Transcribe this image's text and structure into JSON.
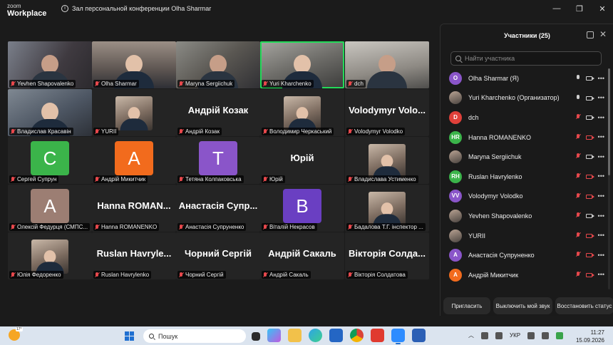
{
  "titlebar": {
    "logo_top": "zoom",
    "logo_bottom": "Workplace",
    "meeting_title": "Зал персональной конференции Olha Sharmar"
  },
  "gallery": {
    "tiles": [
      {
        "name": "Yevhen Shapovalenko",
        "kind": "video"
      },
      {
        "name": "Olha Sharmar",
        "kind": "video"
      },
      {
        "name": "Maryna Sergiichuk",
        "kind": "video"
      },
      {
        "name": "Yuri Kharchenko",
        "kind": "video",
        "active": true
      },
      {
        "name": "dch",
        "kind": "video"
      },
      {
        "name": "Владислав Красавін",
        "kind": "video"
      },
      {
        "name": "YURII",
        "kind": "photo"
      },
      {
        "name": "Андрій Козак",
        "big": "Андрій Козак",
        "kind": "text"
      },
      {
        "name": "Володимир Черкаський",
        "kind": "photo"
      },
      {
        "name": "Volodymyr Volodko",
        "big": "Volodymyr Volo...",
        "kind": "text"
      },
      {
        "name": "Сергей Супрун",
        "letter": "С",
        "kind": "avatar",
        "color": "#3bb44a"
      },
      {
        "name": "Андрій Микитчик",
        "letter": "А",
        "kind": "avatar",
        "color": "#f26b1d"
      },
      {
        "name": "Тетяна Колпаковська",
        "letter": "Т",
        "kind": "avatar",
        "color": "#8a55c9"
      },
      {
        "name": "Юрій",
        "big": "Юрій",
        "kind": "text"
      },
      {
        "name": "Владислава Устименко",
        "kind": "photo"
      },
      {
        "name": "Олексій Федурця (СМПС...",
        "letter": "А",
        "kind": "avatar",
        "color": "#9c7e73"
      },
      {
        "name": "Hanna ROMANENKO",
        "big": "Hanna ROMAN...",
        "kind": "text"
      },
      {
        "name": "Анастасія Супруненко",
        "big": "Анастасія Супр...",
        "kind": "text"
      },
      {
        "name": "Віталій Некрасов",
        "letter": "В",
        "kind": "avatar",
        "color": "#6a3fc2"
      },
      {
        "name": "Бадалова Т.Г. інспектор ...",
        "kind": "photo"
      },
      {
        "name": "Юлія Федоренко",
        "kind": "photo"
      },
      {
        "name": "Ruslan Havrylenko",
        "big": "Ruslan Havryle...",
        "kind": "text"
      },
      {
        "name": "Чорний Сергій",
        "big": "Чорний Сергій",
        "kind": "text"
      },
      {
        "name": "Андрій Сакаль",
        "big": "Андрій Сакаль",
        "kind": "text"
      },
      {
        "name": "Вікторія Солдатова",
        "big": "Вікторія Солда...",
        "kind": "text"
      }
    ]
  },
  "participants_panel": {
    "title": "Участники (25)",
    "search_placeholder": "Найти участника",
    "items": [
      {
        "name": "Olha Sharmar (Я)",
        "avatar": "O",
        "color": "#8a55c9",
        "mic_on": true,
        "cam_on": true
      },
      {
        "name": "Yuri Kharchenko (Организатор)",
        "avatar": "",
        "photo": true,
        "mic_on": true,
        "cam_on": true
      },
      {
        "name": "dch",
        "avatar": "D",
        "color": "#e0403a",
        "mic_on": false,
        "cam_on": true
      },
      {
        "name": "Hanna ROMANENKO",
        "avatar": "HR",
        "color": "#3bb44a",
        "mic_on": false,
        "cam_on": false
      },
      {
        "name": "Maryna Sergiichuk",
        "avatar": "",
        "photo": true,
        "mic_on": false,
        "cam_on": true
      },
      {
        "name": "Ruslan Havrylenko",
        "avatar": "RH",
        "color": "#3bb44a",
        "mic_on": false,
        "cam_on": false
      },
      {
        "name": "Volodymyr Volodko",
        "avatar": "VV",
        "color": "#8a55c9",
        "mic_on": false,
        "cam_on": false
      },
      {
        "name": "Yevhen Shapovalenko",
        "avatar": "",
        "photo": true,
        "mic_on": false,
        "cam_on": true
      },
      {
        "name": "YURII",
        "avatar": "",
        "photo": true,
        "mic_on": false,
        "cam_on": false
      },
      {
        "name": "Анастасія Супруненко",
        "avatar": "А",
        "color": "#8a55c9",
        "mic_on": false,
        "cam_on": false
      },
      {
        "name": "Андрій Микитчик",
        "avatar": "А",
        "color": "#f26b1d",
        "mic_on": false,
        "cam_on": false
      }
    ],
    "buttons": {
      "invite": "Пригласить",
      "mute_me": "Выключить мой звук",
      "restore_status": "Восстановить статус"
    }
  },
  "taskbar": {
    "weather_temp": "17°",
    "search_label": "Пошук",
    "language": "УКР",
    "time": "11:27",
    "date": "15.09.2026"
  }
}
